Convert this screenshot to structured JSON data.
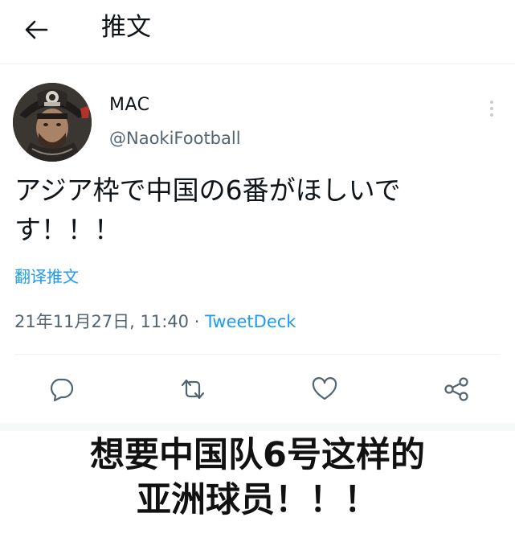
{
  "header": {
    "back_icon": "arrow-left-icon",
    "title": "推文"
  },
  "tweet": {
    "author": {
      "name": "MAC",
      "handle": "@NaokiFootball",
      "avatar": "avatar-samurai-helmet"
    },
    "text_line1": "アジア枠で中国の6番がほしいで",
    "text_line2": "す！！！",
    "translate_label": "翻译推文",
    "timestamp": "21年11月27日, 11:40 · ",
    "source": "TweetDeck",
    "actions": [
      {
        "icon": "reply-icon"
      },
      {
        "icon": "retweet-icon"
      },
      {
        "icon": "like-icon"
      },
      {
        "icon": "share-icon"
      }
    ]
  },
  "caption": {
    "line1": "想要中国队6号这样的",
    "line2": "亚洲球员！！！"
  },
  "colors": {
    "accent": "#1d9bf0",
    "text_primary": "#0f1419",
    "text_secondary": "#536471",
    "divider": "#eff3f4"
  }
}
